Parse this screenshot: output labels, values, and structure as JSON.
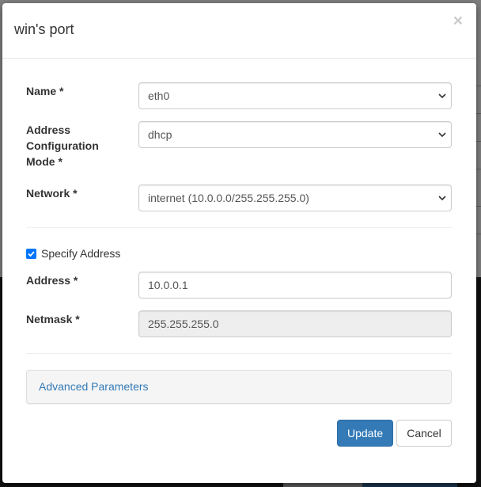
{
  "modal": {
    "title": "win's port",
    "close_label": "×"
  },
  "form": {
    "name": {
      "label": "Name *",
      "value": "eth0"
    },
    "address_mode": {
      "label": "Address Configuration Mode *",
      "value": "dhcp"
    },
    "network": {
      "label": "Network *",
      "value": "internet (10.0.0.0/255.255.255.0)"
    },
    "specify_address": {
      "label": "Specify Address",
      "checked": true
    },
    "address": {
      "label": "Address *",
      "value": "10.0.0.1"
    },
    "netmask": {
      "label": "Netmask *",
      "value": "255.255.255.0"
    }
  },
  "advanced": {
    "label": "Advanced Parameters"
  },
  "buttons": {
    "update": "Update",
    "cancel": "Cancel"
  },
  "colors": {
    "primary": "#337ab7",
    "checkbox": "#0075ff"
  }
}
